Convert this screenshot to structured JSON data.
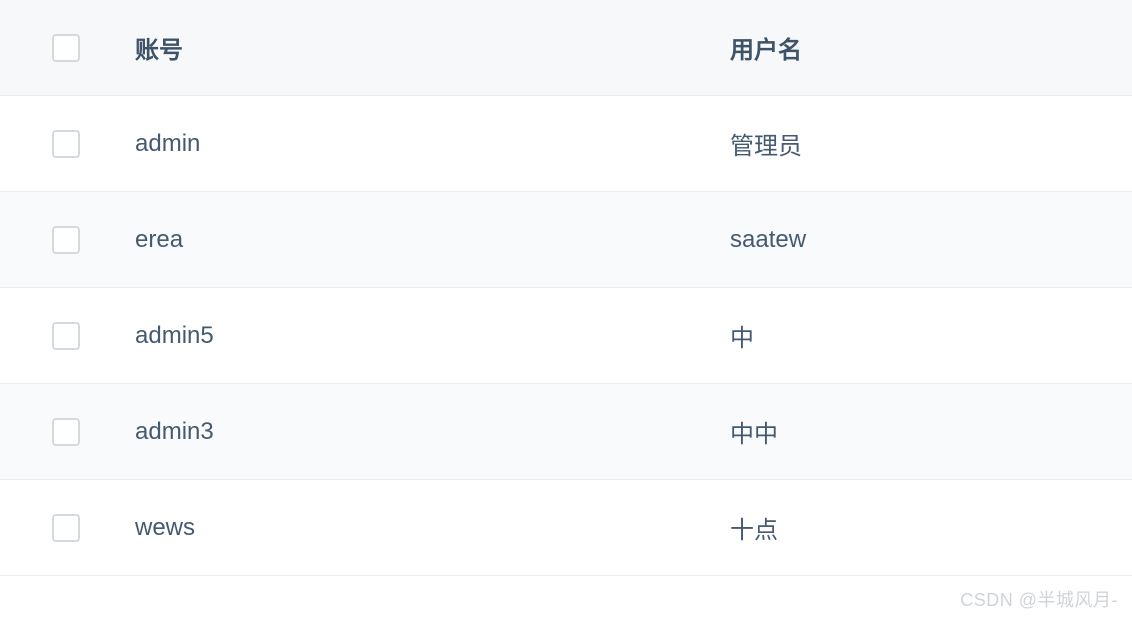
{
  "table": {
    "headers": {
      "account": "账号",
      "username": "用户名"
    },
    "rows": [
      {
        "account": "admin",
        "username": "管理员"
      },
      {
        "account": "erea",
        "username": "saatew"
      },
      {
        "account": "admin5",
        "username": "中"
      },
      {
        "account": "admin3",
        "username": "中中"
      },
      {
        "account": "wews",
        "username": "十点"
      }
    ]
  },
  "watermark": "CSDN @半城风月-"
}
